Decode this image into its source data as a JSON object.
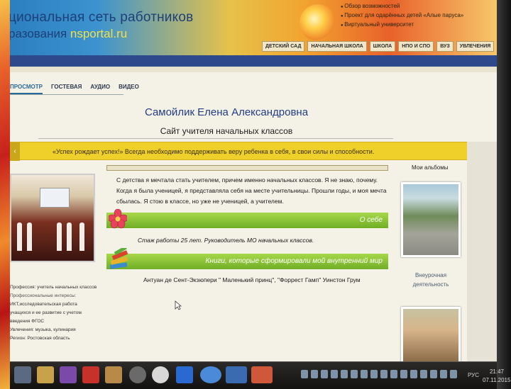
{
  "site": {
    "logo_line1": "циональная сеть работников",
    "logo_line2_prefix": "разования ",
    "logo_line2_brand": "nsportal.ru",
    "top_links": [
      "Обзор возможностей",
      "Проект для одарённых детей «Алые паруса»",
      "Виртуальный университет"
    ],
    "nav": [
      "ДЕТСКИЙ САД",
      "НАЧАЛЬНАЯ ШКОЛА",
      "ШКОЛА",
      "НПО И СПО",
      "ВУЗ",
      "УВЛЕЧЕНИЯ"
    ]
  },
  "tabs": [
    "ПРОСМОТР",
    "ГОСТЕВАЯ",
    "АУДИО",
    "ВИДЕО"
  ],
  "page_title": "Самойлик Елена Александровна",
  "subtitle": "Сайт учителя начальных классов",
  "quote": "«Успех рождает успех!» Всегда необходимо поддерживать веру ребенка в себя, в свои силы и способности.",
  "intro": "С детства я мечтала стать учителем, причем именно начальных классов. Я не знаю, почему. Когда я была ученицей, я представляла себя на месте учительницы. Прошли годы, и моя мечта сбылась. Я стою в классе, но уже не ученицей, а учителем.",
  "sections": {
    "about_title": "О себе",
    "about_text": "Стаж работы 25 лет. Руководитель МО начальных классов.",
    "books_title": "Книги, которые сформировали мой внутренний мир",
    "books_text": "Антуан де Сент-Экзюпери \" Маленький принц\", \"Форрест Гамп\" Уинстон Грум"
  },
  "profile": {
    "profession": "Профессия: учитель начальных классов",
    "interests_label": "Профессиональные интересы:",
    "interests": [
      "ИКТ,исследовательская работа",
      "учащихся и ее развитие с учетом",
      "введения ФГОС"
    ],
    "hobbies": "Увлечения: музыка, кулинария",
    "region": "Регион: Ростовская область"
  },
  "albums": {
    "title": "Мои альбомы",
    "album1_caption": "Внеурочная деятельность"
  },
  "taskbar": {
    "lang": "РУС",
    "time": "21:47",
    "date": "07.11.2015"
  },
  "colors": {
    "header_blue": "#2e4a8c",
    "quote_yellow": "#efcf2a",
    "section_green": "#6fae26",
    "title_blue": "#223d86"
  }
}
